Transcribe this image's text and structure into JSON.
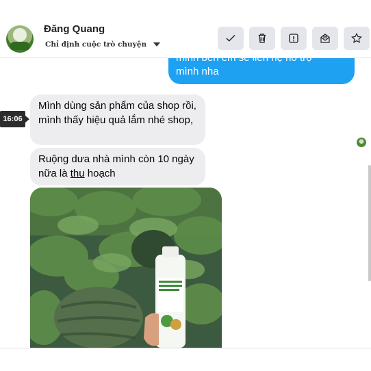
{
  "header": {
    "contact_name": "Đăng Quang",
    "assign_label": "Chỉ định cuộc trò chuyện",
    "actions": [
      {
        "icon": "check-icon",
        "label": "Mark done"
      },
      {
        "icon": "trash-icon",
        "label": "Delete"
      },
      {
        "icon": "alert-icon",
        "label": "Spam"
      },
      {
        "icon": "mail-icon",
        "label": "Unread"
      },
      {
        "icon": "star-icon",
        "label": "Star"
      }
    ]
  },
  "messages": {
    "outgoing_partial": "mình bên em sẽ liên hệ hỗ trợ",
    "outgoing_line2": "mình nha",
    "incoming_1": "Mình dùng sản phẩm của shop rồi, mình thấy hiệu quả lắm nhé shop,",
    "incoming_2_part1": "Ruộng dưa nhà mình còn 10 ngày nữa là ",
    "incoming_2_underlined": "thu",
    "incoming_2_part2": " hoạch",
    "timestamp": "16:06"
  },
  "colors": {
    "outgoing_bubble": "#1fa1f1",
    "incoming_bubble": "#ededef",
    "action_button": "#e4e6eb"
  }
}
